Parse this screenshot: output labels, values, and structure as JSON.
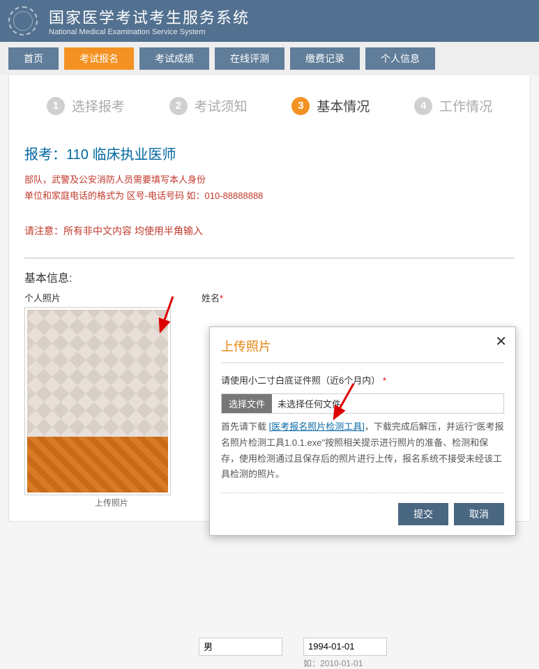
{
  "header": {
    "title_cn": "国家医学考试考生服务系统",
    "title_en": "National Medical Examination Service System"
  },
  "nav": {
    "items": [
      "首页",
      "考试报名",
      "考试成绩",
      "在线评测",
      "缴费记录",
      "个人信息"
    ],
    "active_index": 1
  },
  "steps": [
    {
      "num": "1",
      "label": "选择报考",
      "active": false
    },
    {
      "num": "2",
      "label": "考试须知",
      "active": false
    },
    {
      "num": "3",
      "label": "基本情况",
      "active": true
    },
    {
      "num": "4",
      "label": "工作情况",
      "active": false
    }
  ],
  "exam": {
    "title": "报考：110 临床执业医师",
    "warn1_line1": "部队，武警及公安消防人员需要填写本人身份",
    "warn1_line2": "单位和家庭电话的格式为 区号-电话号码 如：010-88888888",
    "warn2": "请注意：所有非中文内容 均使用半角输入"
  },
  "section": {
    "basic_info": "基本信息:",
    "photo_label": "个人照片",
    "photo_caption": "上传照片",
    "name_label": "姓名",
    "gender_value": "男",
    "date_value": "1994-01-01",
    "date_hint": "如：2010-01-01"
  },
  "modal": {
    "title": "上传照片",
    "tip": "请使用小二寸白底证件照（近6个月内）",
    "file_btn": "选择文件",
    "file_status": "未选择任何文件",
    "desc_prefix": "首先请下载 ",
    "desc_link": "[医考报名照片检测工具]",
    "desc_rest": "，下载完成后解压，并运行\"医考报名照片检测工具1.0.1.exe\"按照相关提示进行照片的准备、检测和保存，使用检测通过且保存后的照片进行上传，报名系统不接受未经该工具检测的照片。",
    "submit": "提交",
    "cancel": "取消"
  }
}
